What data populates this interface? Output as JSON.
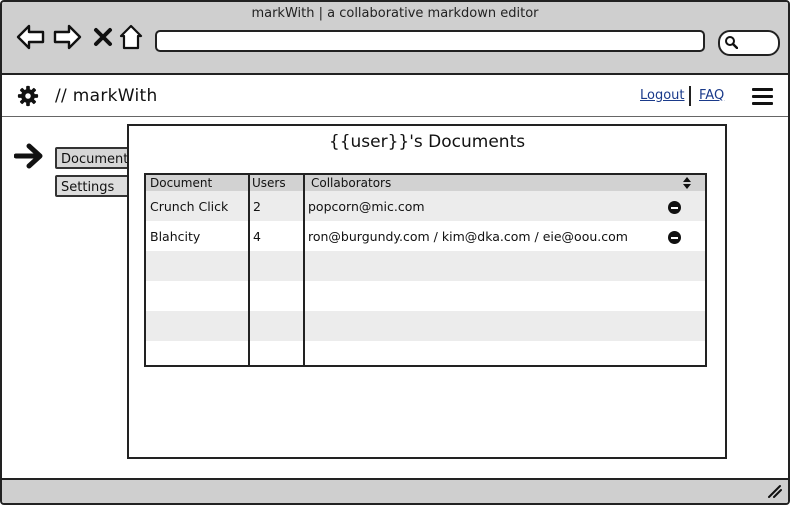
{
  "window": {
    "title": "markWith | a collaborative markdown editor"
  },
  "icons": {
    "back": "back-arrow-icon",
    "forward": "forward-arrow-icon",
    "stop": "close-icon",
    "home": "home-icon",
    "search": "search-icon",
    "settings": "gear-icon",
    "menu": "hamburger-menu-icon",
    "pointer": "arrow-right-icon",
    "remove": "minus-circle-icon",
    "sort": "sort-icon",
    "resize": "resize-grip-icon"
  },
  "header": {
    "brand": "// markWith",
    "logout": "Logout",
    "faq": "FAQ"
  },
  "sidebar": {
    "items": [
      {
        "label": "Documents"
      },
      {
        "label": "Settings"
      }
    ]
  },
  "panel": {
    "title": "{{user}}'s Documents"
  },
  "table": {
    "columns": [
      "Document",
      "Users",
      "Collaborators"
    ],
    "rows": [
      {
        "document": "Crunch Click",
        "users": "2",
        "collaborators": "popcorn@mic.com"
      },
      {
        "document": "Blahcity",
        "users": "4",
        "collaborators": "ron@burgundy.com / kim@dka.com / eie@oou.com"
      }
    ]
  }
}
